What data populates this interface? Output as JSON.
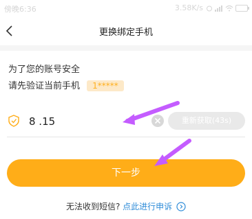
{
  "status_bar": {
    "time": "傍晚6:36",
    "network_speed": "3.58K/s"
  },
  "header": {
    "title": "更换绑定手机"
  },
  "intro": {
    "line1": "为了您的账号安全",
    "line2": "请先验证当前手机",
    "masked_phone": "1*****"
  },
  "verification": {
    "code_value": "8 .15",
    "resend_label": "重新获取(43s)"
  },
  "actions": {
    "next_label": "下一步"
  },
  "help": {
    "question": "无法收到短信?",
    "link": "点此进行申诉"
  },
  "colors": {
    "accent": "#ffad18",
    "link": "#2f8cd8",
    "annotation_arrow": "#c45cff"
  }
}
